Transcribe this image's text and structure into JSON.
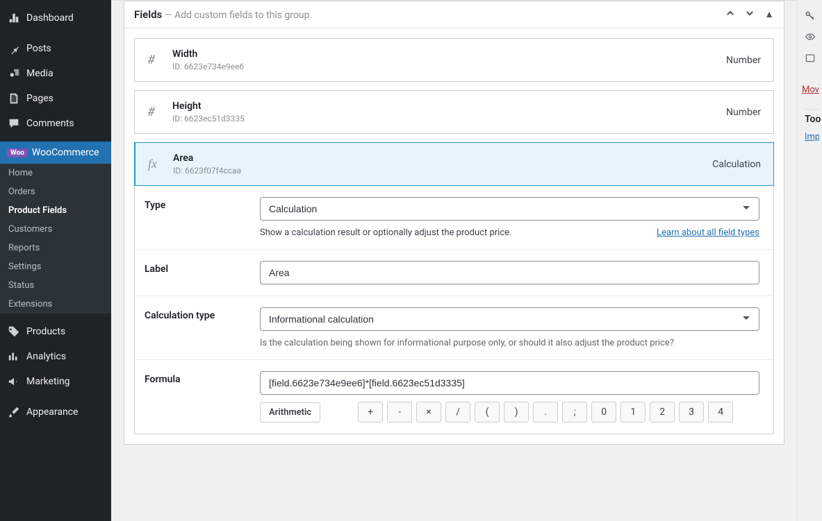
{
  "sidebar": {
    "items": [
      {
        "icon": "dash",
        "label": "Dashboard"
      },
      {
        "icon": "pin",
        "label": "Posts"
      },
      {
        "icon": "media",
        "label": "Media"
      },
      {
        "icon": "page",
        "label": "Pages"
      },
      {
        "icon": "comment",
        "label": "Comments"
      }
    ],
    "woo": {
      "badge": "Woo",
      "label": "WooCommerce"
    },
    "woo_sub": [
      "Home",
      "Orders",
      "Product Fields",
      "Customers",
      "Reports",
      "Settings",
      "Status",
      "Extensions"
    ],
    "more": [
      {
        "icon": "tag",
        "label": "Products"
      },
      {
        "icon": "chart",
        "label": "Analytics"
      },
      {
        "icon": "megaphone",
        "label": "Marketing"
      },
      {
        "icon": "brush",
        "label": "Appearance"
      }
    ]
  },
  "panel": {
    "title": "Fields",
    "subtitle": " — Add custom fields to this group."
  },
  "fields": [
    {
      "icon": "#",
      "name": "Width",
      "id": "ID: 6623e734e9ee6",
      "type": "Number"
    },
    {
      "icon": "#",
      "name": "Height",
      "id": "ID: 6623ec51d3335",
      "type": "Number"
    },
    {
      "icon": "fx",
      "name": "Area",
      "id": "ID: 6623f07f4ccaa",
      "type": "Calculation"
    }
  ],
  "editor": {
    "type_label": "Type",
    "type_value": "Calculation",
    "type_hint": "Show a calculation result or optionally adjust the product price.",
    "learn_link": "Learn about all field types",
    "label_label": "Label",
    "label_value": "Area",
    "calc_type_label": "Calculation type",
    "calc_type_value": "Informational calculation",
    "calc_type_hint": "Is the calculation being shown for informational purpose only, or should it also adjust the product price?",
    "formula_label": "Formula",
    "formula_value": "[field.6623e734e9ee6]*[field.6623ec51d3335]",
    "arith_label": "Arithmetic",
    "arith_buttons": [
      "+",
      "-",
      "×",
      "/",
      "(",
      ")",
      ".",
      ";",
      "0",
      "1",
      "2",
      "3",
      "4"
    ]
  },
  "rail": {
    "move_link": "Mov",
    "tools_title": "Too",
    "import_link": "Imp"
  }
}
